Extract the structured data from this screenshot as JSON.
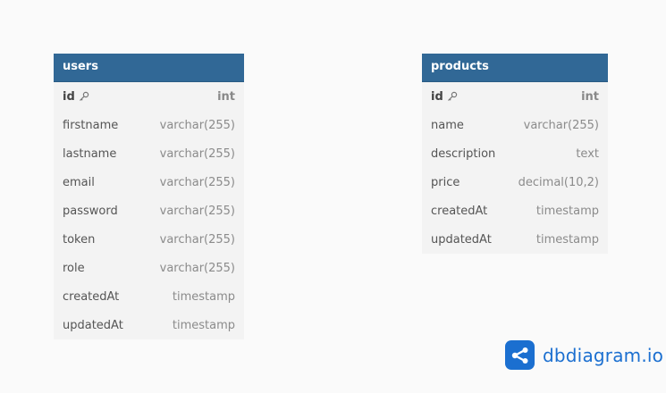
{
  "tables": [
    {
      "name": "users",
      "columns": [
        {
          "name": "id",
          "type": "int",
          "pk": true
        },
        {
          "name": "firstname",
          "type": "varchar(255)",
          "pk": false
        },
        {
          "name": "lastname",
          "type": "varchar(255)",
          "pk": false
        },
        {
          "name": "email",
          "type": "varchar(255)",
          "pk": false
        },
        {
          "name": "password",
          "type": "varchar(255)",
          "pk": false
        },
        {
          "name": "token",
          "type": "varchar(255)",
          "pk": false
        },
        {
          "name": "role",
          "type": "varchar(255)",
          "pk": false
        },
        {
          "name": "createdAt",
          "type": "timestamp",
          "pk": false
        },
        {
          "name": "updatedAt",
          "type": "timestamp",
          "pk": false
        }
      ]
    },
    {
      "name": "products",
      "columns": [
        {
          "name": "id",
          "type": "int",
          "pk": true
        },
        {
          "name": "name",
          "type": "varchar(255)",
          "pk": false
        },
        {
          "name": "description",
          "type": "text",
          "pk": false
        },
        {
          "name": "price",
          "type": "decimal(10,2)",
          "pk": false
        },
        {
          "name": "createdAt",
          "type": "timestamp",
          "pk": false
        },
        {
          "name": "updatedAt",
          "type": "timestamp",
          "pk": false
        }
      ]
    }
  ],
  "brand": {
    "text": "dbdiagram.io",
    "color": "#1b6fd0"
  },
  "colors": {
    "header": "#316896",
    "table_bg": "#f3f3f3",
    "canvas": "#fafafa"
  },
  "icons": {
    "primary_key": "key-icon"
  }
}
